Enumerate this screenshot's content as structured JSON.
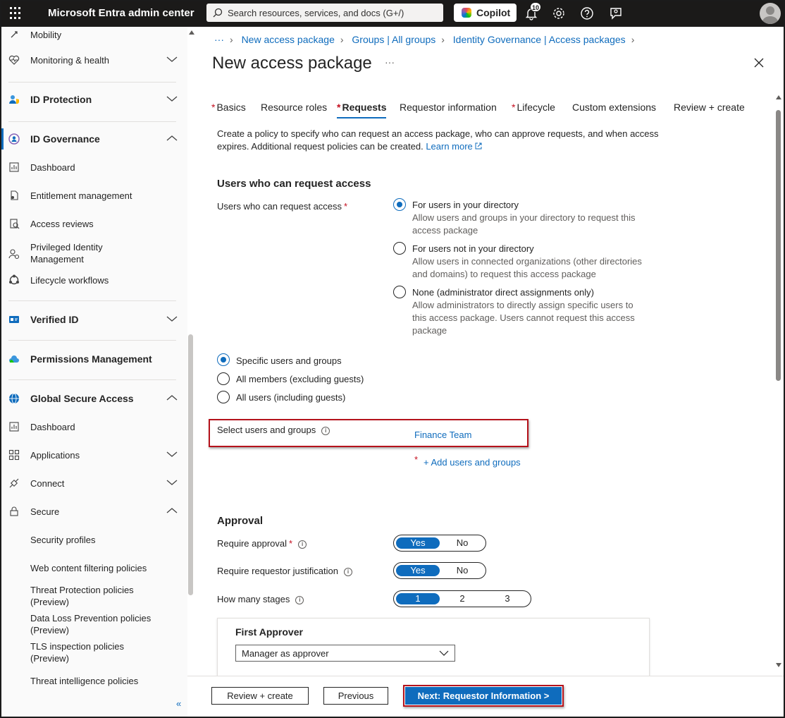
{
  "topbar": {
    "brand": "Microsoft Entra admin center",
    "search_placeholder": "Search resources, services, and docs (G+/)",
    "copilot_label": "Copilot",
    "notifications_count": "10"
  },
  "sidebar": {
    "items": [
      {
        "label": "Mobility"
      },
      {
        "label": "Monitoring & health"
      },
      {
        "label": "ID Protection"
      },
      {
        "label": "ID Governance"
      },
      {
        "label": "Dashboard"
      },
      {
        "label": "Entitlement management"
      },
      {
        "label": "Access reviews"
      },
      {
        "label": "Privileged Identity Management"
      },
      {
        "label": "Lifecycle workflows"
      },
      {
        "label": "Verified ID"
      },
      {
        "label": "Permissions Management"
      },
      {
        "label": "Global Secure Access"
      },
      {
        "label": "Dashboard"
      },
      {
        "label": "Applications"
      },
      {
        "label": "Connect"
      },
      {
        "label": "Secure"
      },
      {
        "label": "Security profiles"
      },
      {
        "label": "Web content filtering policies"
      },
      {
        "label": "Threat Protection policies (Preview)"
      },
      {
        "label": "Data Loss Prevention policies (Preview)"
      },
      {
        "label": "TLS inspection policies (Preview)"
      },
      {
        "label": "Threat intelligence policies"
      }
    ],
    "collapse_glyph": "«"
  },
  "breadcrumb": {
    "ellipsis": "···",
    "items": [
      "New access package",
      "Groups | All groups",
      "Identity Governance | Access packages"
    ]
  },
  "page": {
    "title": "New access package",
    "more": "···"
  },
  "tabs": [
    {
      "label": "Basics",
      "required": true
    },
    {
      "label": "Resource roles",
      "required": false
    },
    {
      "label": "Requests",
      "required": true
    },
    {
      "label": "Requestor information",
      "required": false
    },
    {
      "label": "Lifecycle",
      "required": true
    },
    {
      "label": "Custom extensions",
      "required": false
    },
    {
      "label": "Review + create",
      "required": false
    }
  ],
  "description": {
    "text": "Create a policy to specify who can request an access package, who can approve requests, and when access expires. Additional request policies can be created.",
    "learn_more": "Learn more"
  },
  "who_can_request": {
    "heading": "Users who can request access",
    "field_label": "Users who can request access",
    "options": [
      {
        "title": "For users in your directory",
        "desc": "Allow users and groups in your directory to request this access package",
        "selected": true
      },
      {
        "title": "For users not in your directory",
        "desc": "Allow users in connected organizations (other directories and domains) to request this access package",
        "selected": false
      },
      {
        "title": "None (administrator direct assignments only)",
        "desc": "Allow administrators to directly assign specific users to this access package. Users cannot request this access package",
        "selected": false
      }
    ],
    "scope_options": [
      {
        "title": "Specific users and groups",
        "selected": true
      },
      {
        "title": "All members (excluding guests)",
        "selected": false
      },
      {
        "title": "All users (including guests)",
        "selected": false
      }
    ],
    "select_label": "Select users and groups",
    "selected_value": "Finance Team",
    "add_link": "+ Add users and groups"
  },
  "approval": {
    "heading": "Approval",
    "require_approval_label": "Require approval",
    "require_justification_label": "Require requestor justification",
    "stages_label": "How many stages",
    "yes": "Yes",
    "no": "No",
    "stage_options": [
      "1",
      "2",
      "3"
    ],
    "selected_stage": "1",
    "first_approver_heading": "First Approver",
    "first_approver_value": "Manager as approver"
  },
  "footer": {
    "review_create": "Review + create",
    "previous": "Previous",
    "next": "Next: Requestor Information >"
  },
  "colors": {
    "accent": "#0f6cbd",
    "required": "#c50f1f",
    "highlight_box": "#b5121b",
    "topbar": "#1b1a19"
  }
}
